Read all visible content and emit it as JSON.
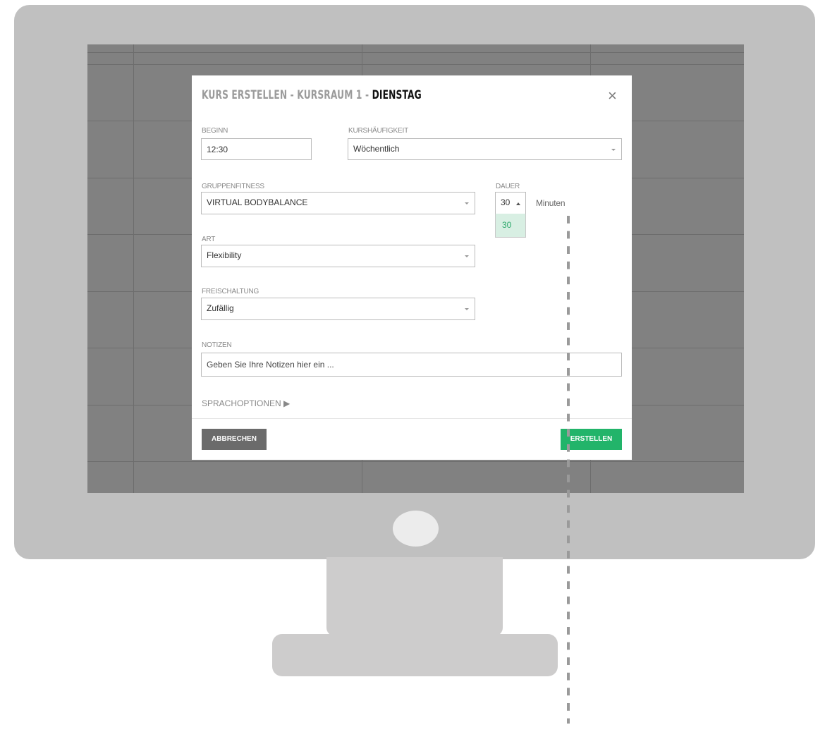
{
  "modal": {
    "title_prefix": "KURS ERSTELLEN - KURSRAUM 1 - ",
    "title_day": "DIENSTAG",
    "close_symbol": "×"
  },
  "fields": {
    "beginn": {
      "label": "BEGINN",
      "value": "12:30"
    },
    "kurshaeufigkeit": {
      "label": "KURSHÄUFIGKEIT",
      "value": "Wöchentlich"
    },
    "gruppenfitness": {
      "label": "GRUPPENFITNESS",
      "value": "VIRTUAL BODYBALANCE"
    },
    "dauer": {
      "label": "DAUER",
      "value": "30",
      "unit": "Minuten",
      "options": [
        "30"
      ]
    },
    "art": {
      "label": "ART",
      "value": "Flexibility"
    },
    "freischaltung": {
      "label": "FREISCHALTUNG",
      "value": "Zufällig"
    },
    "notizen": {
      "label": "NOTIZEN",
      "placeholder": "Geben Sie Ihre Notizen hier ein ..."
    }
  },
  "language_options": "SPRACHOPTIONEN ▶",
  "buttons": {
    "cancel": "ABBRECHEN",
    "create": "ERSTELLEN"
  },
  "colors": {
    "accent": "#22b46a",
    "cancel": "#6b6b6b",
    "overlay": "#818181"
  }
}
